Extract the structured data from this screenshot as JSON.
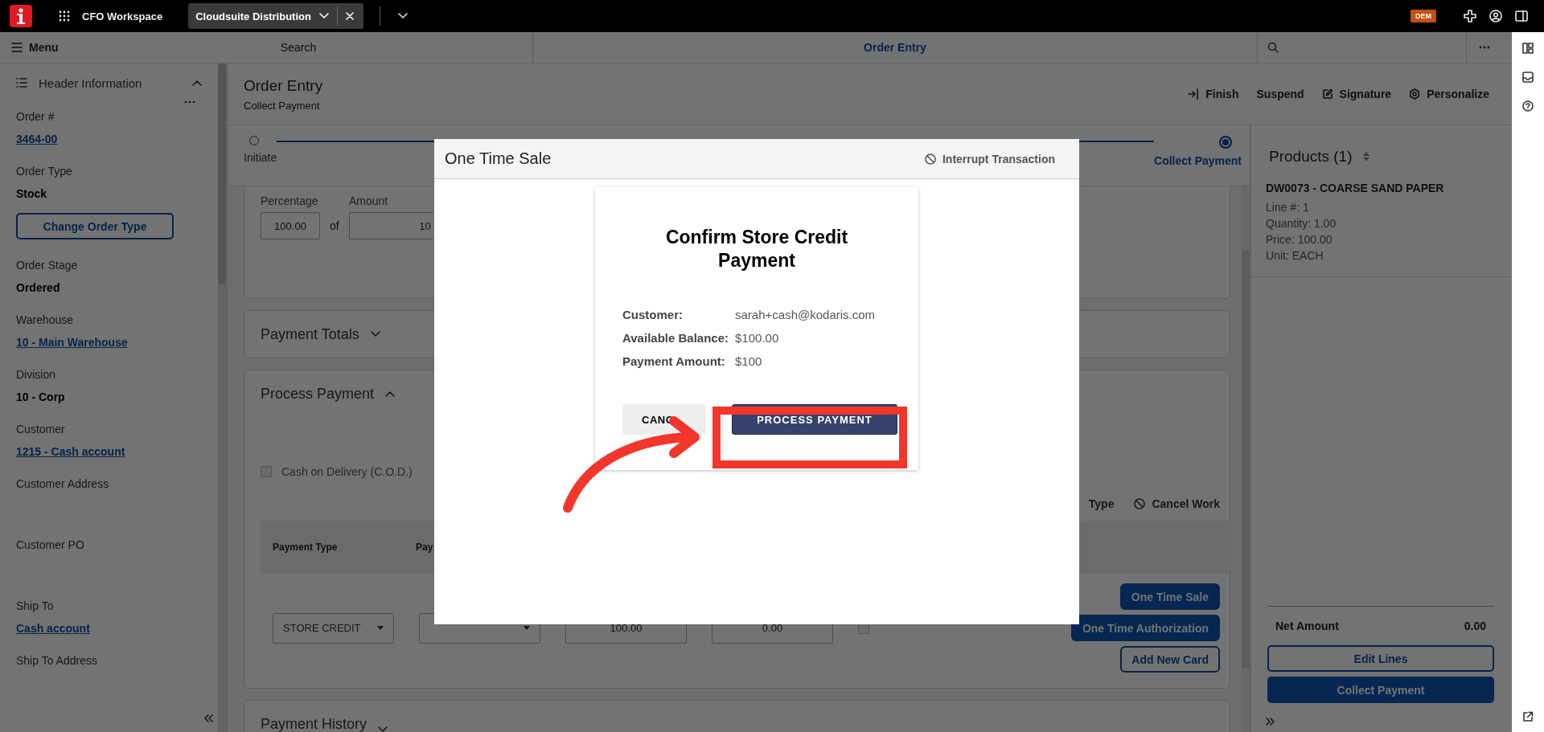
{
  "top_bar": {
    "workspace": "CFO Workspace",
    "tabs": [
      {
        "label": "Cloudsuite Distribution",
        "selected": true
      }
    ],
    "badge": "DEM"
  },
  "nav_bar": {
    "menu": "Menu",
    "search": "Search",
    "title": "Order Entry"
  },
  "sidebar": {
    "title": "Header Information",
    "expanded": true,
    "items": [
      {
        "kind": "field",
        "label": "Order #",
        "value": "3464-00",
        "link": true
      },
      {
        "kind": "field",
        "label": "Order Type",
        "value": "Stock",
        "link": false
      },
      {
        "kind": "button",
        "label": "Change Order Type"
      },
      {
        "kind": "field",
        "label": "Order Stage",
        "value": "Ordered",
        "link": false
      },
      {
        "kind": "field",
        "label": "Warehouse",
        "value": "10 - Main Warehouse",
        "link": true
      },
      {
        "kind": "field",
        "label": "Division",
        "value": "10 - Corp",
        "link": false
      },
      {
        "kind": "field",
        "label": "Customer",
        "value": "1215 - Cash account",
        "link": true
      },
      {
        "kind": "field",
        "label": "Customer Address"
      },
      {
        "kind": "field",
        "label": "Customer PO"
      },
      {
        "kind": "field",
        "label": "Ship To",
        "value": "Cash account",
        "link": true
      },
      {
        "kind": "field",
        "label": "Ship To Address"
      }
    ]
  },
  "page": {
    "title": "Order Entry",
    "subtitle": "Collect Payment",
    "actions": [
      {
        "kind": "finish",
        "label": "Finish"
      },
      {
        "kind": "plain",
        "label": "Suspend"
      },
      {
        "kind": "signature",
        "label": "Signature"
      },
      {
        "kind": "personalize",
        "label": "Personalize"
      }
    ]
  },
  "stepper": [
    {
      "label": "Initiate",
      "selected": false
    },
    {
      "label": "Collect Payment",
      "selected": true
    }
  ],
  "amount_card": {
    "percentage_label": "Percentage",
    "amount_label": "Amount",
    "percentage": "100.00",
    "of": "of",
    "amount": "10"
  },
  "payment_totals": {
    "title": "Payment Totals",
    "expanded": false
  },
  "process_payment": {
    "title": "Process Payment",
    "expanded": true,
    "cod": {
      "label": "Cash on Delivery (C.O.D.)",
      "checked": false
    },
    "actions": [
      {
        "kind": "plain",
        "label": "Type"
      },
      {
        "kind": "cancel",
        "label": "Cancel Work"
      }
    ],
    "columns": [
      "Payment Type",
      "Pay"
    ],
    "row": {
      "payment_type": "STORE CREDIT",
      "amount": "100.00",
      "column_4": "0.00",
      "checked": false
    },
    "buttons": [
      {
        "label": "One Time Sale",
        "kind": "filled"
      },
      {
        "label": "One Time Authorization",
        "kind": "filled"
      },
      {
        "label": "Add New Card",
        "kind": "outline"
      }
    ]
  },
  "payment_history": {
    "title": "Payment History",
    "expanded": false
  },
  "products": {
    "title": "Products (1)",
    "items": [
      {
        "name": "DW0073 - COARSE SAND PAPER",
        "details": [
          "Line #: 1",
          "Quantity: 1.00",
          "Price: 100.00",
          "Unit: EACH"
        ]
      }
    ],
    "net_label": "Net Amount",
    "net_value": "0.00",
    "buttons": [
      {
        "label": "Edit Lines",
        "kind": "outline"
      },
      {
        "label": "Collect Payment",
        "kind": "filled"
      }
    ]
  },
  "modal": {
    "title": "One Time Sale",
    "interrupt": "Interrupt Transaction",
    "heading": "Confirm Store Credit Payment",
    "rows": [
      {
        "label": "Customer:",
        "value": "sarah+cash@kodaris.com"
      },
      {
        "label": "Available Balance:",
        "value": "$100.00"
      },
      {
        "label": "Payment Amount:",
        "value": "$100"
      }
    ],
    "cancel": "CANC",
    "confirm": "PROCESS PAYMENT"
  }
}
